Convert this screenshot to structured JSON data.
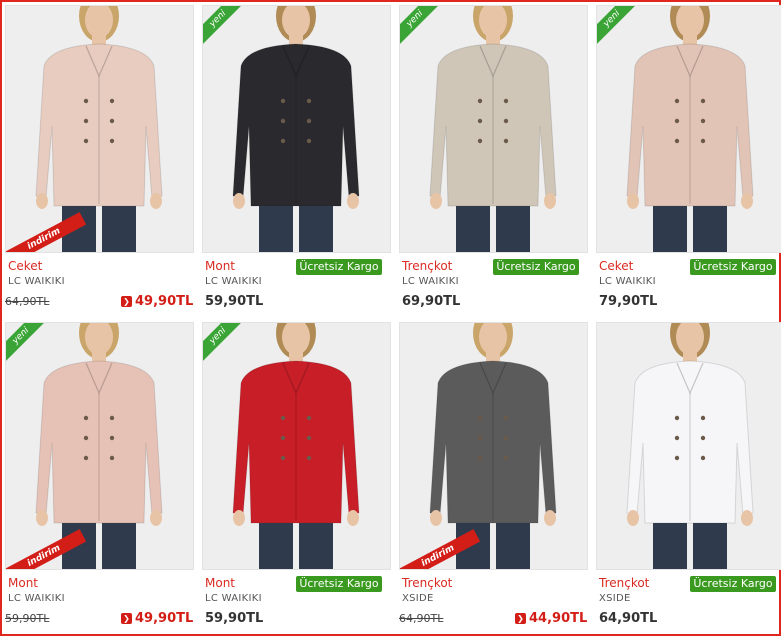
{
  "badges": {
    "yeni": "yeni",
    "indirim": "indirim",
    "kargo": "Ücretsiz Kargo"
  },
  "products": [
    {
      "category": "Ceket",
      "brand": "LC WAIKIKI",
      "old_price": "64,90TL",
      "price": "49,90TL",
      "yeni": false,
      "indirim": true,
      "free_shipping": false,
      "color": "#e8ccc0"
    },
    {
      "category": "Mont",
      "brand": "LC WAIKIKI",
      "price": "59,90TL",
      "yeni": true,
      "indirim": false,
      "free_shipping": true,
      "color": "#2a2a2e"
    },
    {
      "category": "Trençkot",
      "brand": "LC WAIKIKI",
      "price": "69,90TL",
      "yeni": true,
      "indirim": false,
      "free_shipping": true,
      "color": "#cfc6b8"
    },
    {
      "category": "Ceket",
      "brand": "LC WAIKIKI",
      "price": "79,90TL",
      "yeni": true,
      "indirim": false,
      "free_shipping": true,
      "color": "#e2c4b6"
    },
    {
      "category": "Mont",
      "brand": "LC WAIKIKI",
      "old_price": "59,90TL",
      "price": "49,90TL",
      "yeni": true,
      "indirim": true,
      "free_shipping": false,
      "color": "#e6c2b6"
    },
    {
      "category": "Mont",
      "brand": "LC WAIKIKI",
      "price": "59,90TL",
      "yeni": true,
      "indirim": false,
      "free_shipping": true,
      "color": "#c81e28"
    },
    {
      "category": "Trençkot",
      "brand": "XSIDE",
      "old_price": "64,90TL",
      "price": "44,90TL",
      "yeni": false,
      "indirim": true,
      "free_shipping": false,
      "color": "#5b5b5b"
    },
    {
      "category": "Trençkot",
      "brand": "XSIDE",
      "price": "64,90TL",
      "yeni": false,
      "indirim": false,
      "free_shipping": true,
      "color": "#f6f6f8"
    }
  ]
}
